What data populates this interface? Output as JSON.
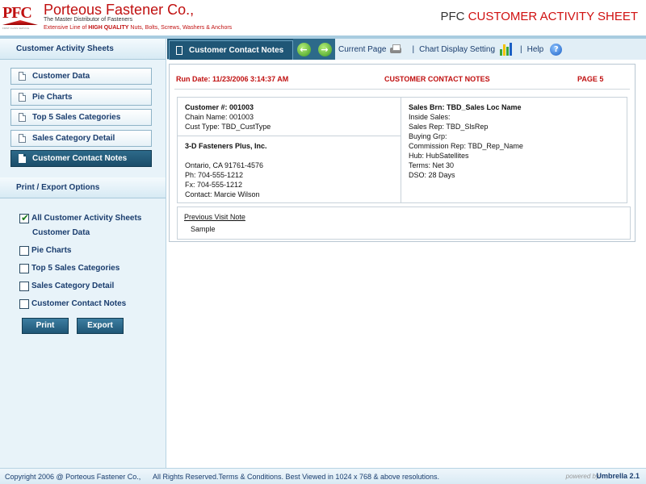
{
  "header": {
    "logo_text": "PFC",
    "logo_tagline": "FIRST CLASS SERVICE",
    "company_name": "Porteous Fastener Co.,",
    "company_sub": "The Master Distributor of Fasteners",
    "tagline_pre": "Extensive Line of ",
    "tagline_bold": "HIGH QUALITY",
    "tagline_post": " Nuts, Bolts, Screws, Washers & Anchors",
    "sheet_title_prefix": "PFC",
    "sheet_title_red": "CUSTOMER ACTIVITY SHEET"
  },
  "sidebar": {
    "title": "Customer Activity Sheets",
    "items": [
      {
        "label": "Customer Data"
      },
      {
        "label": "Pie Charts"
      },
      {
        "label": "Top 5 Sales Categories"
      },
      {
        "label": "Sales Category Detail"
      },
      {
        "label": "Customer Contact Notes"
      }
    ],
    "print_title": "Print / Export Options",
    "options": {
      "all": "All Customer Activity Sheets",
      "all_sub": "Customer Data",
      "pie": "Pie Charts",
      "top5": "Top 5 Sales Categories",
      "detail": "Sales Category Detail",
      "notes": "Customer Contact Notes"
    },
    "print_label": "Print",
    "export_label": "Export"
  },
  "toolbar": {
    "active_tab": "Customer Contact Notes",
    "back_glyph": "←",
    "forward_glyph": "→",
    "current_page": "Current Page",
    "chart_setting": "Chart Display Setting",
    "help": "Help",
    "sep": "|",
    "help_glyph": "?"
  },
  "report": {
    "run_date": "Run Date: 11/23/2006 3:14:37 AM",
    "title": "CUSTOMER CONTACT NOTES",
    "page": "PAGE 5",
    "customer": {
      "number": "Customer #: 001003",
      "chain": "Chain Name: 001003",
      "type": "Cust Type: TBD_CustType"
    },
    "address": {
      "name": "3-D Fasteners Plus, Inc.",
      "city": "Ontario, CA 91761-4576",
      "phone": "Ph: 704-555-1212",
      "fax": "Fx: 704-555-1212",
      "contact": "Contact: Marcie Wilson"
    },
    "sales": {
      "branch": "Sales Brn: TBD_Sales Loc Name",
      "inside": "Inside Sales:",
      "rep": "Sales Rep: TBD_SlsRep",
      "buying": "Buying Grp:",
      "commission": "Commission Rep: TBD_Rep_Name",
      "hub": "Hub: HubSatellites",
      "terms": "Terms: Net 30",
      "dso": "DSO: 28 Days"
    },
    "notes": {
      "link": "Previous Visit Note",
      "text": "Sample"
    }
  },
  "footer": {
    "copyright": "Copyright 2006 @ Porteous Fastener Co.,",
    "rights": "All Rights Reserved.Terms & Conditions.  Best Viewed in 1024 x 768 & above resolutions.",
    "powered": "powered by",
    "product": "Umbrella 2.1"
  },
  "colors": {
    "brand_red": "#c01010",
    "nav_dark": "#1f5676",
    "sidebar_bg": "#e8f3f9",
    "bar_icon": [
      "#3aa53a",
      "#f2c200",
      "#3aa53a",
      "#1b5fc4"
    ]
  }
}
